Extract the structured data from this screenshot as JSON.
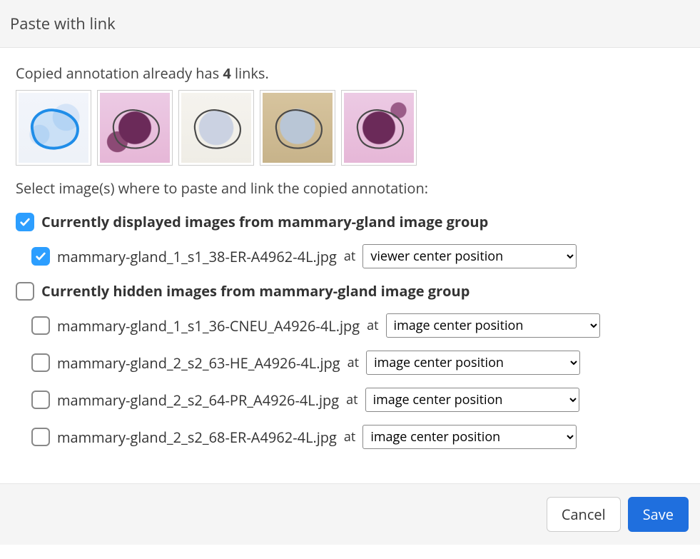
{
  "header": {
    "title": "Paste with link"
  },
  "links_line": {
    "prefix": "Copied annotation already has ",
    "count": "4",
    "suffix": " links."
  },
  "thumbs": [
    {
      "name": "link-thumb-1",
      "outline_stroke": "#1f8de8",
      "outline_fill": "rgba(31,141,232,0.18)"
    },
    {
      "name": "link-thumb-2",
      "outline_stroke": "#4a4a4a",
      "outline_fill": "rgba(0,0,0,0)"
    },
    {
      "name": "link-thumb-3",
      "outline_stroke": "#4a4a4a",
      "outline_fill": "rgba(0,0,0,0)"
    },
    {
      "name": "link-thumb-4",
      "outline_stroke": "#4a4a4a",
      "outline_fill": "rgba(0,0,0,0)"
    },
    {
      "name": "link-thumb-5",
      "outline_stroke": "#4a4a4a",
      "outline_fill": "rgba(0,0,0,0)"
    }
  ],
  "select_prompt": "Select image(s) where to paste and link the copied annotation:",
  "position_options": [
    "viewer center position",
    "image center position"
  ],
  "groups": [
    {
      "checked": true,
      "title": "Currently displayed images from mammary-gland image group",
      "images": [
        {
          "checked": true,
          "filename": "mammary-gland_1_s1_38-ER-A4962-4L.jpg",
          "at": " at ",
          "position": "viewer center position"
        }
      ]
    },
    {
      "checked": false,
      "title": "Currently hidden images from mammary-gland image group",
      "images": [
        {
          "checked": false,
          "filename": "mammary-gland_1_s1_36-CNEU_A4926-4L.jpg",
          "at": " at ",
          "position": "image center position"
        },
        {
          "checked": false,
          "filename": "mammary-gland_2_s2_63-HE_A4926-4L.jpg",
          "at": " at ",
          "position": "image center position"
        },
        {
          "checked": false,
          "filename": "mammary-gland_2_s2_64-PR_A4926-4L.jpg",
          "at": " at ",
          "position": "image center position"
        },
        {
          "checked": false,
          "filename": "mammary-gland_2_s2_68-ER-A4962-4L.jpg",
          "at": " at ",
          "position": "image center position"
        }
      ]
    }
  ],
  "footer": {
    "cancel": "Cancel",
    "save": "Save"
  }
}
